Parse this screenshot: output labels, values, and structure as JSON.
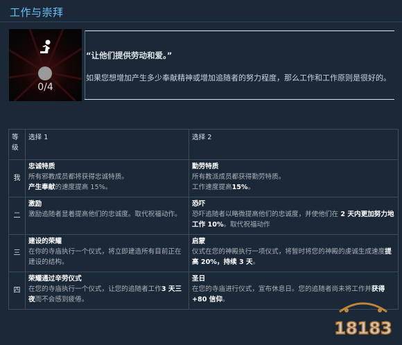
{
  "section": {
    "title": "工作与崇拜"
  },
  "feature": {
    "icon": "praying-figure-icon",
    "progress": "0/4",
    "quote": "“让他们提供劳动和爱。”",
    "description": "如果您想增加产生多少奉献精神或增加追随者的努力程度，那么工作和工作原则是很好的。"
  },
  "table": {
    "headers": [
      "等级",
      "选择 1",
      "选择 2"
    ],
    "rows": [
      {
        "rank": "我",
        "opt1": {
          "title": "忠诚特质",
          "line1": "所有邪教成员都将获得忠诚特质。",
          "pre": "",
          "hl": "产生奉献",
          "post": "的速度提高 15%。"
        },
        "opt2": {
          "title": "勤劳特质",
          "line1": "所有教派成员都获得勤劳特质。",
          "pre": "工作速度提高",
          "hl": "15%",
          "post": "。"
        }
      },
      {
        "rank": "二",
        "opt1": {
          "title": "激励",
          "line1": "激励追随者显着提高他们的忠诚度。取代祝福动作。",
          "pre": "",
          "hl": "",
          "post": ""
        },
        "opt2": {
          "title": "恐吓",
          "line1": "恐吓追随者以略微提高他们的忠诚度，并使他们在",
          "pre": "",
          "hl": " 2 天内更加努力地工作 10%",
          "post": "。取代祝福动作"
        }
      },
      {
        "rank": "三",
        "opt1": {
          "title": "建设的荣耀",
          "line1": "在你的寺庙执行一个仪式，将立即建造所有目前正在建设的结构。",
          "pre": "",
          "hl": "",
          "post": ""
        },
        "opt2": {
          "title": "启蒙",
          "line1": "仪式在您的神殿执行一项仪式，将暂时将您的神殿的虔诚生成速度",
          "pre": "",
          "hl": "提高 20%，持续 3 天",
          "post": "。"
        }
      },
      {
        "rank": "四",
        "opt1": {
          "title": "荣耀通过辛劳仪式",
          "line1": "在您的寺庙执行一个仪式，让您的追随者工作",
          "pre": "",
          "hl": "3 天三夜",
          "post": "而不会感到疲倦。"
        },
        "opt2": {
          "title": "圣日",
          "line1": "在您的寺庙进行仪式，宣布休息日。您的追随者尚未将工作并",
          "pre": "",
          "hl": "获得 +80 信仰",
          "post": "。"
        }
      }
    ]
  },
  "watermark": {
    "text": "18183"
  },
  "colors": {
    "background": "#1b2838",
    "accent": "#67c1f5",
    "text": "#acb2b8",
    "highlight": "#ffffff"
  }
}
